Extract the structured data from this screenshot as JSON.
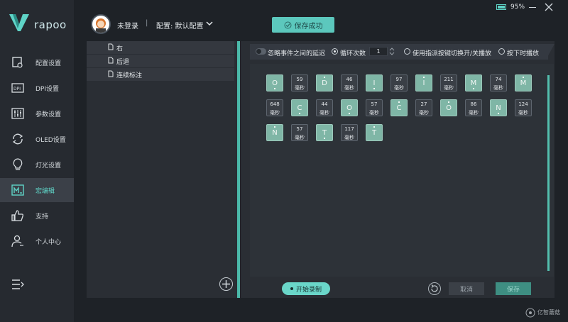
{
  "brand": {
    "name": "rapoo"
  },
  "header": {
    "login_status": "未登录",
    "separator": "|",
    "config_label": "配置: 默认配置",
    "save_toast": "保存成功",
    "battery_level": 0.95,
    "battery_text": "95%"
  },
  "sidebar": {
    "items": [
      {
        "label": "配置设置",
        "icon": "config-icon"
      },
      {
        "label": "DPI设置",
        "icon": "dpi-icon"
      },
      {
        "label": "参数设置",
        "icon": "sliders-icon"
      },
      {
        "label": "OLED设置",
        "icon": "sync-icon"
      },
      {
        "label": "灯光设置",
        "icon": "bulb-icon"
      },
      {
        "label": "宏编辑",
        "icon": "macro-icon",
        "active": true
      },
      {
        "label": "支持",
        "icon": "thumbs-up-icon"
      },
      {
        "label": "个人中心",
        "icon": "user-icon"
      }
    ]
  },
  "macro_list": {
    "items": [
      {
        "label": "右"
      },
      {
        "label": "后退"
      },
      {
        "label": "连续标注"
      }
    ]
  },
  "options": {
    "ignore_delay_label": "忽略事件之间的延迟",
    "loop_label": "循环次数",
    "loop_value": "1",
    "toggle_label": "使用指派按键切换开/关播放",
    "hold_label": "按下时播放"
  },
  "sequence": {
    "unit": "毫秒",
    "rows": [
      [
        {
          "type": "key",
          "key": "O",
          "dir": "down"
        },
        {
          "type": "delay",
          "ms": "59"
        },
        {
          "type": "key",
          "key": "D",
          "dir": "up"
        },
        {
          "type": "delay",
          "ms": "46"
        },
        {
          "type": "key",
          "key": "I",
          "dir": "down"
        },
        {
          "type": "delay",
          "ms": "97"
        },
        {
          "type": "key",
          "key": "I",
          "dir": "up"
        },
        {
          "type": "delay",
          "ms": "211"
        },
        {
          "type": "key",
          "key": "M",
          "dir": "down"
        },
        {
          "type": "delay",
          "ms": "74"
        },
        {
          "type": "key",
          "key": "M",
          "dir": "up"
        }
      ],
      [
        {
          "type": "delay",
          "ms": "648"
        },
        {
          "type": "key",
          "key": "C",
          "dir": "down"
        },
        {
          "type": "delay",
          "ms": "44"
        },
        {
          "type": "key",
          "key": "O",
          "dir": "down"
        },
        {
          "type": "delay",
          "ms": "57"
        },
        {
          "type": "key",
          "key": "C",
          "dir": "up"
        },
        {
          "type": "delay",
          "ms": "27"
        },
        {
          "type": "key",
          "key": "O",
          "dir": "up"
        },
        {
          "type": "delay",
          "ms": "86"
        },
        {
          "type": "key",
          "key": "N",
          "dir": "down"
        },
        {
          "type": "delay",
          "ms": "124"
        }
      ],
      [
        {
          "type": "key",
          "key": "N",
          "dir": "up"
        },
        {
          "type": "delay",
          "ms": "57"
        },
        {
          "type": "key",
          "key": "T",
          "dir": "down"
        },
        {
          "type": "delay",
          "ms": "117"
        },
        {
          "type": "key",
          "key": "T",
          "dir": "up"
        }
      ]
    ]
  },
  "footer": {
    "record_label": "开始录制",
    "cancel_label": "取消",
    "save_label": "保存"
  },
  "watermark": {
    "text": "亿智蘑菇"
  },
  "colors": {
    "accent": "#5fd4c7",
    "tile": "#7fb6a6",
    "bg": "#1e2227"
  }
}
